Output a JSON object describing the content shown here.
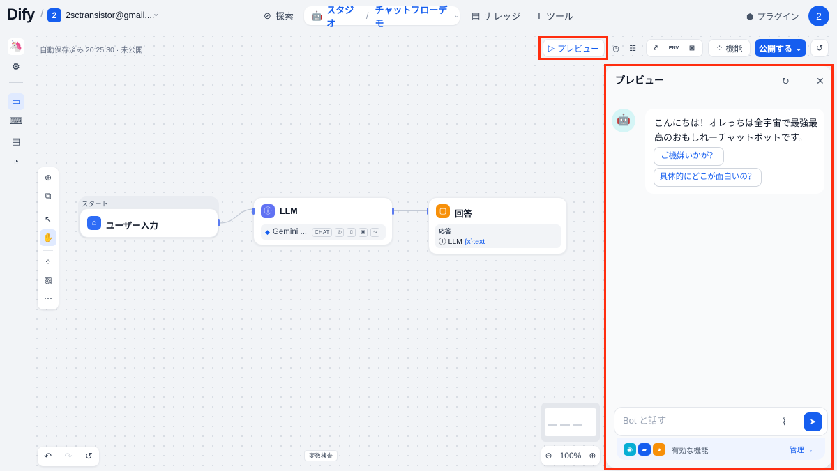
{
  "topbar": {
    "logo": "Dify",
    "workspace_badge": "2",
    "workspace_name": "2sctransistor@gmail....",
    "nav": {
      "explore": "探索",
      "studio": "スタジオ",
      "app_name": "チャットフローデモ",
      "knowledge": "ナレッジ",
      "tools": "ツール"
    },
    "plugin": "プラグイン",
    "avatar": "2"
  },
  "editor": {
    "autosave": "自動保存済み 20:25:30 · 未公開",
    "toolbar": {
      "preview": "プレビュー",
      "features": "機能",
      "publish": "公開する",
      "env_label": "ENV"
    },
    "nodes": {
      "start": {
        "group_label": "スタート",
        "title": "ユーザー入力"
      },
      "llm": {
        "title": "LLM",
        "model": "Gemini ...",
        "mode": "CHAT"
      },
      "answer": {
        "title": "回答",
        "field_label": "応答",
        "source": "LLM",
        "var": "{x}text"
      }
    },
    "var_inspect": "変数検査",
    "zoom": "100%"
  },
  "preview_panel": {
    "title": "プレビュー",
    "bot_message": "こんにちは！オレっちは全宇宙で最強最高のおもしれーチャットボットです。",
    "suggestions": [
      "ご機嫌いかが？",
      "具体的にどこが面白いの？"
    ],
    "input_placeholder": "Bot と話す",
    "features_label": "有効な機能",
    "manage": "管理 →"
  },
  "colors": {
    "accent": "#155eef",
    "highlight": "#ff2d0f",
    "answer_node": "#f79009",
    "llm_node": "#6172f3"
  }
}
